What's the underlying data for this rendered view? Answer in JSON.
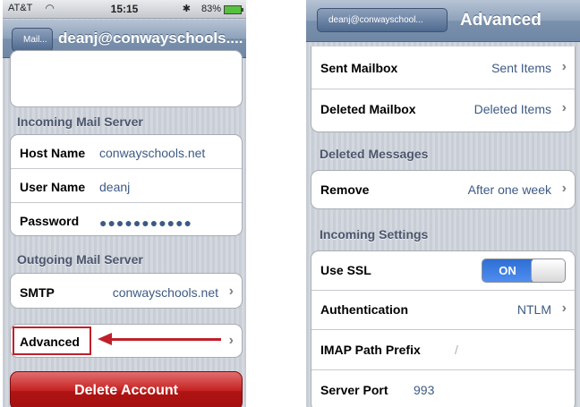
{
  "left": {
    "status": {
      "carrier": "AT&T",
      "time": "15:15",
      "bluetooth": "✱",
      "battery": "83%"
    },
    "nav": {
      "back": "Mail...",
      "title": "deanj@conwayschools...."
    },
    "incoming_header": "Incoming Mail Server",
    "incoming_rows": [
      {
        "label": "Host Name",
        "value": "conwayschools.net"
      },
      {
        "label": "User Name",
        "value": "deanj"
      },
      {
        "label": "Password",
        "value": "●●●●●●●●●●●"
      }
    ],
    "outgoing_header": "Outgoing Mail Server",
    "smtp": {
      "label": "SMTP",
      "value": "conwayschools.net"
    },
    "advanced": {
      "label": "Advanced"
    },
    "delete_label": "Delete Account"
  },
  "right": {
    "nav": {
      "back": "deanj@conwayschool...",
      "title": "Advanced"
    },
    "mailbox_rows": [
      {
        "label": "Sent Mailbox",
        "value": "Sent Items"
      },
      {
        "label": "Deleted Mailbox",
        "value": "Deleted Items"
      }
    ],
    "deleted_header": "Deleted Messages",
    "remove": {
      "label": "Remove",
      "value": "After one week"
    },
    "incoming_settings_header": "Incoming Settings",
    "ssl": {
      "label": "Use SSL",
      "state": "ON"
    },
    "auth": {
      "label": "Authentication",
      "value": "NTLM"
    },
    "imap": {
      "label": "IMAP Path Prefix",
      "value": "/"
    },
    "port": {
      "label": "Server Port",
      "value": "993"
    }
  },
  "colors": {
    "highlight": "#c0202a",
    "delete": "#b01414",
    "value_text": "#3d5a85",
    "toggle_on": "#3a7be0"
  }
}
